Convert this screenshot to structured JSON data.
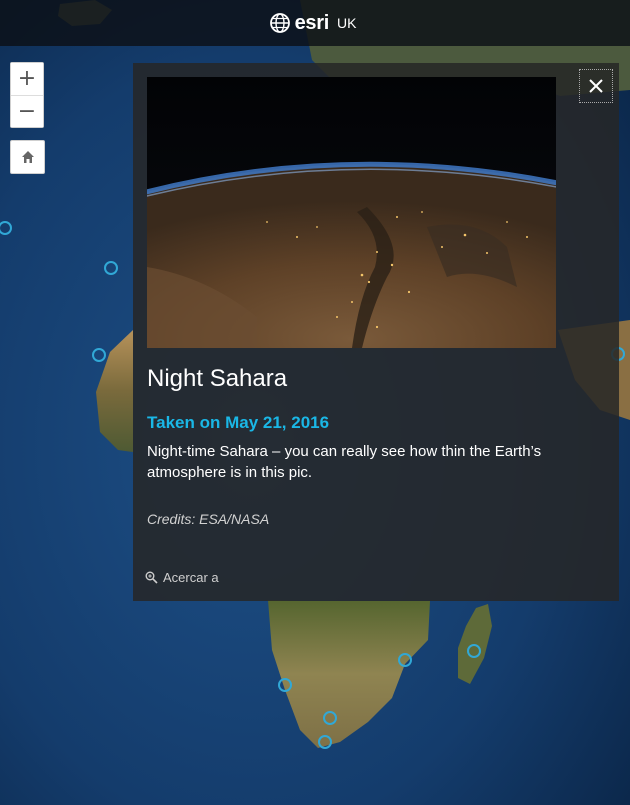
{
  "header": {
    "logo_text": "esri",
    "logo_sub": "UK"
  },
  "map_controls": {
    "zoom_in_label": "+",
    "zoom_out_label": "−",
    "home_icon": "home-icon"
  },
  "popup": {
    "title": "Night Sahara",
    "date": "Taken on May 21, 2016",
    "description": "Night-time Sahara – you can really see how thin the Earth’s atmosphere is in this pic.",
    "credits": "Credits: ESA/NASA",
    "zoom_to_label": "Acercar a",
    "close_icon": "close-icon",
    "zoom_icon": "magnifier-icon"
  },
  "colors": {
    "accent": "#1ab7e6",
    "marker": "#31a8d6",
    "header_bg": "#0c1016",
    "popup_bg": "#262626"
  }
}
